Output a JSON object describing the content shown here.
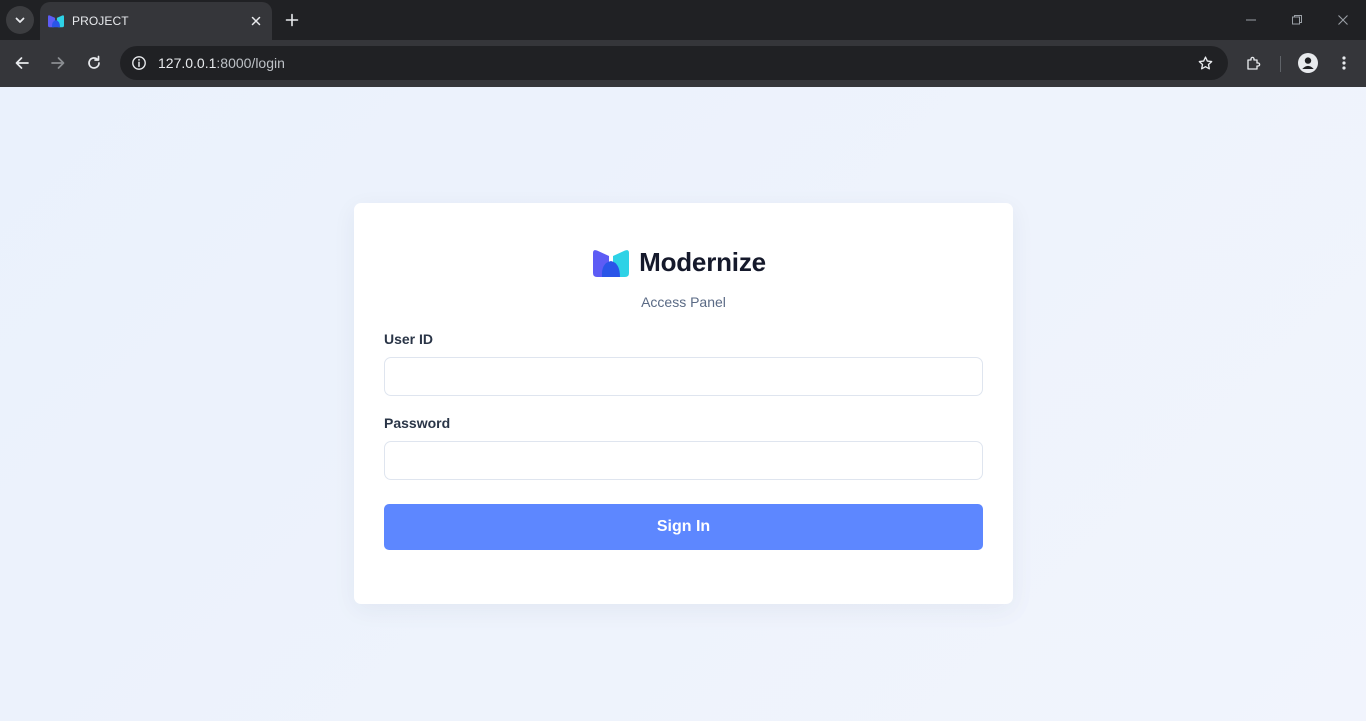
{
  "browser": {
    "tab": {
      "title": "PROJECT"
    },
    "address": {
      "host": "127.0.0.1",
      "path": ":8000/login"
    }
  },
  "page": {
    "brand": {
      "name": "Modernize"
    },
    "subtitle": "Access Panel",
    "form": {
      "user_id": {
        "label": "User ID",
        "value": "",
        "placeholder": ""
      },
      "password": {
        "label": "Password",
        "value": "",
        "placeholder": ""
      },
      "submit_label": "Sign In"
    }
  },
  "icons": {
    "tab_search": "chevron-down-icon",
    "favicon": "modernize-logo-icon",
    "tab_close": "close-icon",
    "new_tab": "plus-icon",
    "back": "arrow-left-icon",
    "forward": "arrow-right-icon",
    "reload": "reload-icon",
    "site_info": "info-icon",
    "bookmark": "star-icon",
    "extensions": "puzzle-icon",
    "profile": "person-icon",
    "menu": "kebab-menu-icon"
  },
  "colors": {
    "accent": "#5d87ff",
    "heading": "#2a3547",
    "brand_text": "#15192b",
    "muted": "#5a6a85",
    "page_bg": "#eaf1fc"
  }
}
